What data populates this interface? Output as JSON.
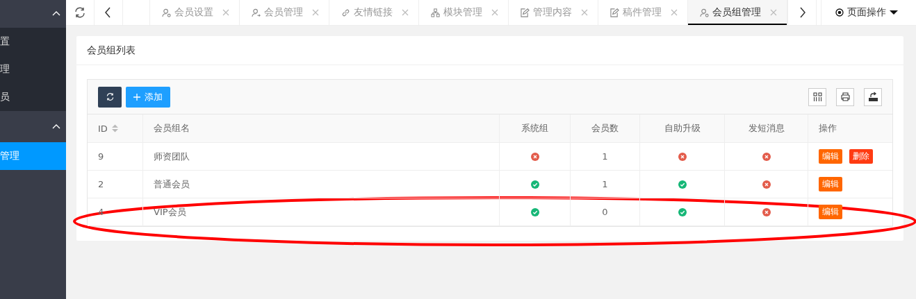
{
  "sidebar": {
    "groups": [
      {
        "expanded": true,
        "items": [
          {
            "label": "置",
            "selected": false
          },
          {
            "label": "理",
            "selected": false
          },
          {
            "label": "员",
            "selected": false
          }
        ]
      },
      {
        "expanded": true,
        "items": [
          {
            "label": "管理",
            "selected": true
          }
        ]
      }
    ]
  },
  "tabs": [
    {
      "kind": "user-gear",
      "label": "会员设置",
      "selected": false
    },
    {
      "kind": "user-arrow",
      "label": "会员管理",
      "selected": false
    },
    {
      "kind": "link",
      "label": "友情链接",
      "selected": false
    },
    {
      "kind": "tree",
      "label": "模块管理",
      "selected": false
    },
    {
      "kind": "edit",
      "label": "管理内容",
      "selected": false
    },
    {
      "kind": "edit",
      "label": "稿件管理",
      "selected": false
    },
    {
      "kind": "user-gear",
      "label": "会员组管理",
      "selected": true
    }
  ],
  "page_actions": "页面操作",
  "card": {
    "title": "会员组列表",
    "add_button": "添加",
    "columns": [
      "ID",
      "会员组名",
      "系统组",
      "会员数",
      "自助升级",
      "发短消息",
      "操作"
    ],
    "rows": [
      {
        "id": "9",
        "name": "师资团队",
        "system": false,
        "count": "1",
        "upgrade": false,
        "sms": false,
        "actions": [
          {
            "kind": "edit",
            "label": "编辑"
          },
          {
            "kind": "delete",
            "label": "删除"
          }
        ]
      },
      {
        "id": "2",
        "name": "普通会员",
        "system": true,
        "count": "1",
        "upgrade": true,
        "sms": false,
        "actions": [
          {
            "kind": "edit",
            "label": "编辑"
          }
        ]
      },
      {
        "id": "4",
        "name": "VIP会员",
        "system": true,
        "count": "0",
        "upgrade": true,
        "sms": false,
        "actions": [
          {
            "kind": "edit",
            "label": "编辑"
          }
        ]
      }
    ]
  },
  "annotations": [
    {
      "kind": "ellipse"
    }
  ]
}
